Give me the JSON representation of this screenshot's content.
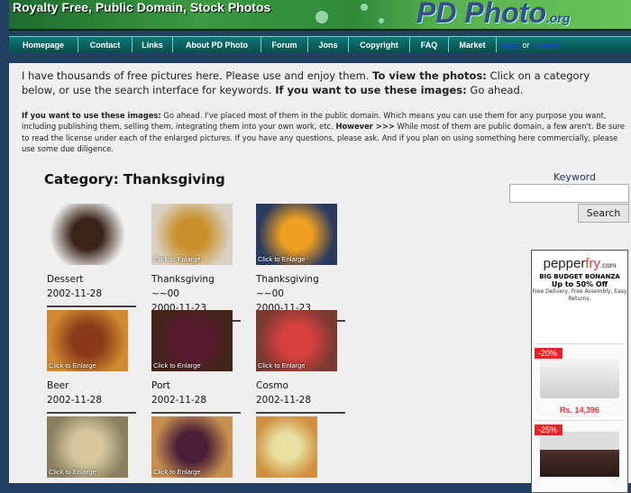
{
  "banner": {
    "tagline": "Royalty Free, Public Domain, Stock Photos",
    "logo_main": "PD Photo",
    "logo_suffix": ".org"
  },
  "nav": {
    "items": [
      "Homepage",
      "Contact",
      "Links",
      "About PD Photo",
      "Forum",
      "Jons",
      "Copyright",
      "FAQ",
      "Market"
    ],
    "login": "log in",
    "or": "or",
    "register": "register"
  },
  "intro": {
    "p1a": "I have thousands of free pictures here. Please use and enjoy them. ",
    "p1b": "To view the photos:",
    "p1c": " Click on a category below, or use the search interface for keywords. ",
    "p1d": "If you want to use these images:",
    "p1e": " Go ahead."
  },
  "notice": {
    "a": "If you want to use these images:",
    "b": " Go ahead. I've placed most of them in the public domain. Which means you can use them for any purpose you want, including publishing them, selling them, integrating them into your own work, etc. ",
    "c": "However >>>",
    "d": " While most of them are public domain, a few aren't. Be sure to read the license under each of the enlarged pictures. If you have any questions, please ask. And if you plan on using something here commercially, please use some due diligence."
  },
  "category": {
    "title": "Category: Thanksgiving"
  },
  "thumb_overlay": "Click to Enlarge",
  "photos": [
    {
      "title": "Dessert",
      "date": "2002-11-28",
      "colors": [
        "#f0f0f0",
        "#3a2418"
      ]
    },
    {
      "title": "Thanksgiving ~~00",
      "date": "2000-11-23",
      "colors": [
        "#d8d0c0",
        "#c8902a"
      ]
    },
    {
      "title": "Thanksgiving ~~00",
      "date": "2000-11-23",
      "colors": [
        "#2a3a60",
        "#f0a020"
      ]
    },
    {
      "title": "Beer",
      "date": "2002-11-28",
      "colors": [
        "#d08a30",
        "#8a3a18"
      ]
    },
    {
      "title": "Port",
      "date": "2002-11-28",
      "colors": [
        "#402418",
        "#5a1a30"
      ]
    },
    {
      "title": "Cosmo",
      "date": "2002-11-28",
      "colors": [
        "#7a3a30",
        "#d84040"
      ]
    },
    {
      "colors": [
        "#8a8060",
        "#d8c8a0"
      ]
    },
    {
      "colors": [
        "#c89050",
        "#4a2038"
      ]
    },
    {
      "colors": [
        "#d09040",
        "#e8e0a0"
      ]
    }
  ],
  "search": {
    "label": "Keyword Search",
    "value": "",
    "button": "Search"
  },
  "ad": {
    "brand_a": "pepper",
    "brand_b": "fry",
    "brand_c": ".com",
    "line1": "BIG BUDGET BONANZA",
    "line2": "Up to 50% Off",
    "line3": "Free Delivery, Free Assembly, Easy Returns.",
    "p1_discount": "-20%",
    "p1_price": "Rs. 14,396",
    "p2_discount": "-25%"
  }
}
